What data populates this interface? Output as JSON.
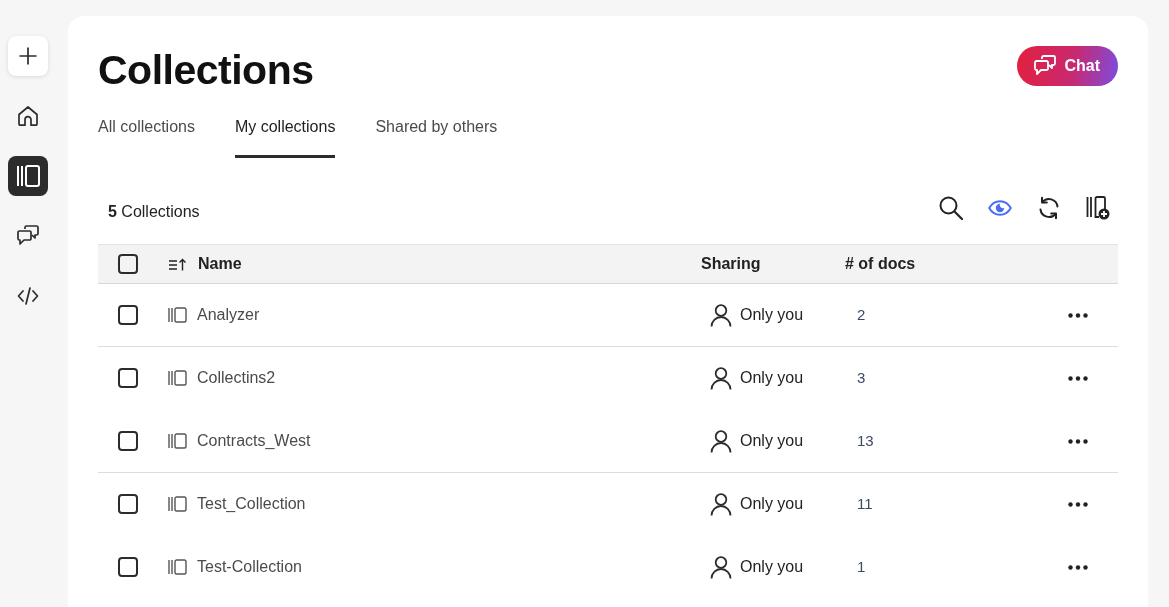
{
  "sidebar": {
    "items": [
      {
        "kind": "add",
        "selected": false
      },
      {
        "kind": "home",
        "selected": false
      },
      {
        "kind": "collections",
        "selected": true
      },
      {
        "kind": "chat",
        "selected": false
      },
      {
        "kind": "code",
        "selected": false
      }
    ]
  },
  "header": {
    "title": "Collections",
    "chat_button": {
      "label": "Chat"
    }
  },
  "tabs": [
    {
      "label": "All collections",
      "selected": false
    },
    {
      "label": "My collections",
      "selected": true
    },
    {
      "label": "Shared by others",
      "selected": false
    }
  ],
  "toolbar": {
    "count": "**5** Collections",
    "tools": [
      {
        "kind": "search",
        "active": false
      },
      {
        "kind": "view",
        "active": true
      },
      {
        "kind": "refresh",
        "active": false
      },
      {
        "kind": "new-collection",
        "active": false
      }
    ]
  },
  "table": {
    "select_all": {
      "checked": false
    },
    "columns": [
      {
        "label": "Name",
        "sorted": true
      },
      {
        "label": "Sharing",
        "sorted": false
      },
      {
        "label": "# of docs",
        "sorted": false
      }
    ],
    "rows": [
      {
        "checked": false,
        "name": "Analyzer",
        "sharing": "Only you",
        "docs": "2",
        "divider_below": true
      },
      {
        "checked": false,
        "name": "Collectins2",
        "sharing": "Only you",
        "docs": "3",
        "divider_below": false
      },
      {
        "checked": false,
        "name": "Contracts_West",
        "sharing": "Only you",
        "docs": "13",
        "divider_below": true
      },
      {
        "checked": false,
        "name": "Test_Collection",
        "sharing": "Only you",
        "docs": "11",
        "divider_below": false
      },
      {
        "checked": false,
        "name": "Test-Collection",
        "sharing": "Only you",
        "docs": "1",
        "divider_below": false
      }
    ]
  }
}
